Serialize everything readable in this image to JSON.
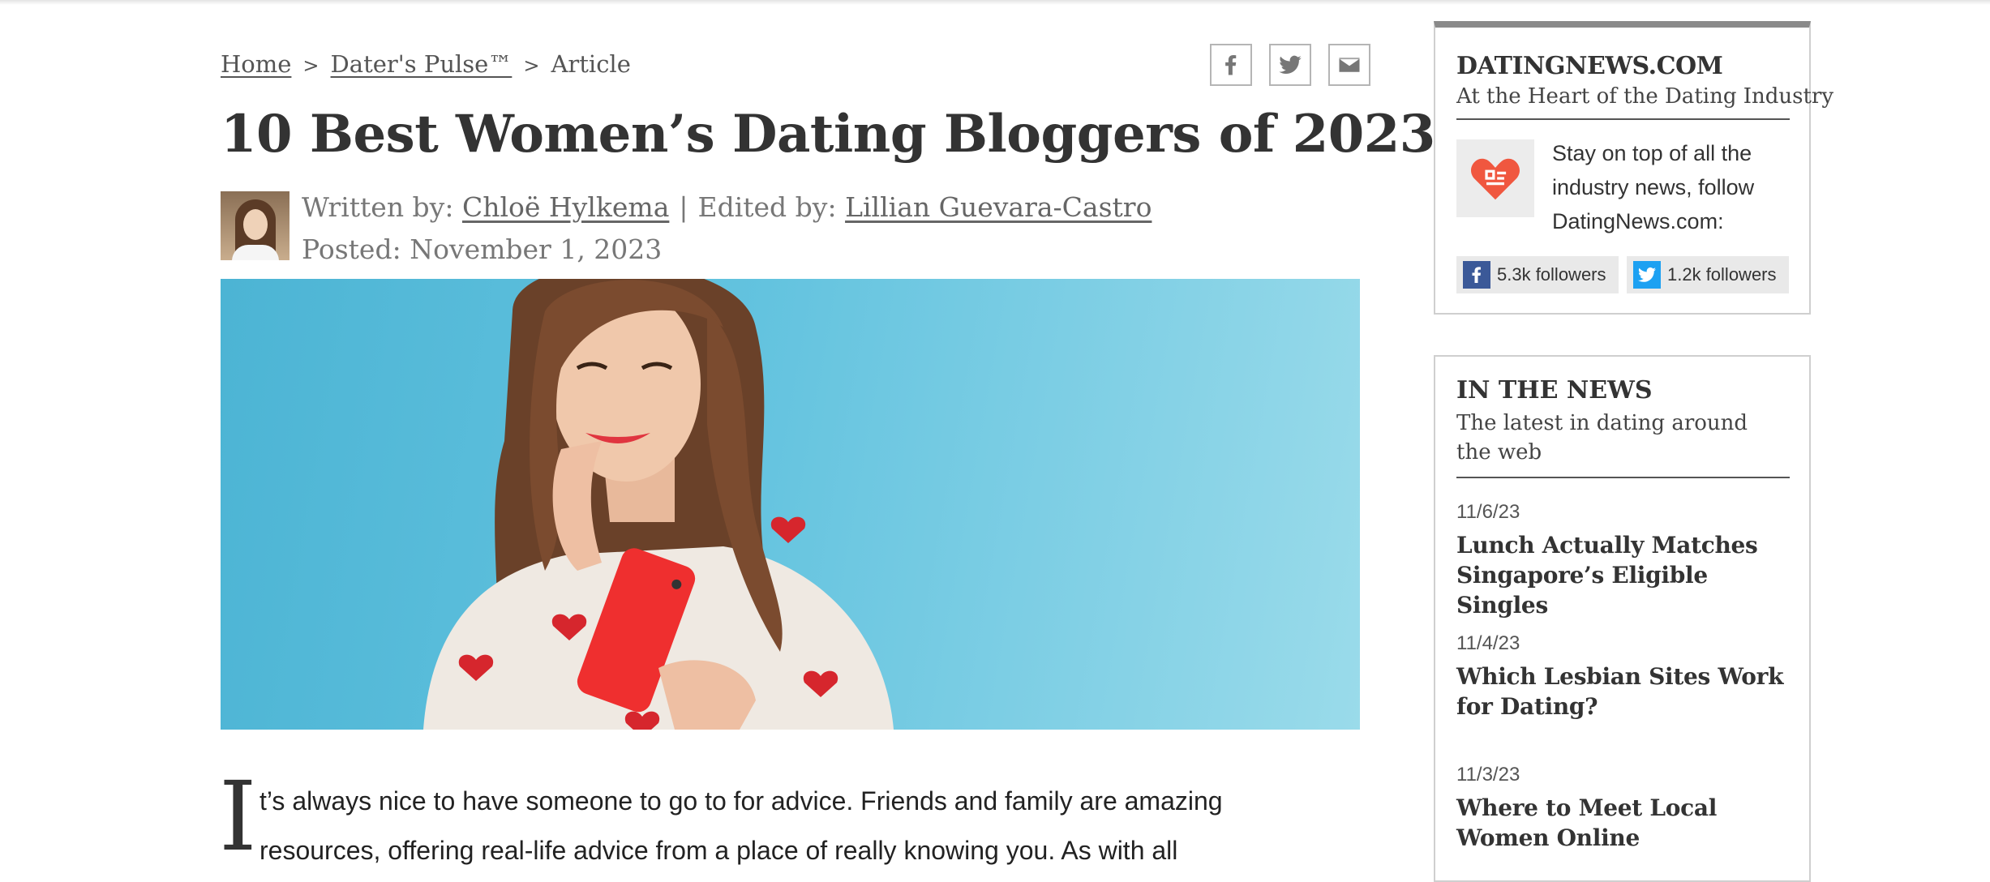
{
  "breadcrumb": {
    "home": "Home",
    "section": "Dater's Pulse™",
    "current": "Article",
    "sep": ">"
  },
  "share": {
    "facebook_icon": "facebook-icon",
    "twitter_icon": "twitter-icon",
    "email_icon": "mail-icon"
  },
  "article": {
    "title": "10 Best Women’s Dating Bloggers of 2023",
    "written_by_label": "Written by:",
    "author": "Chloë Hylkema",
    "edited_by_label": "Edited by:",
    "editor": "Lillian Guevara-Castro",
    "pipe": "|",
    "posted": "Posted: November 1, 2023",
    "dropcap": "I",
    "intro_line1": "t’s always nice to have someone to go to for advice. Friends and family are amazing",
    "intro_line2": "resources, offering real-life advice from a place of really knowing you. As with all"
  },
  "sidebar": {
    "brand": "DATINGNEWS.COM",
    "tagline": "At the Heart of the Dating Industry",
    "follow_text": "Stay on top of all the industry news, follow DatingNews.com:",
    "facebook_followers": "5.3k followers",
    "twitter_followers": "1.2k followers",
    "news_title": "IN THE NEWS",
    "news_subtitle": "The latest in dating around the web",
    "news": [
      {
        "date": "11/6/23",
        "headline": "Lunch Actually Matches Singapore’s Eligible Singles"
      },
      {
        "date": "11/4/23",
        "headline": "Which Lesbian Sites Work for Dating?"
      },
      {
        "date": "11/3/23",
        "headline": "Where to Meet Local Women Online"
      }
    ]
  },
  "colors": {
    "facebook": "#3b5998",
    "twitter": "#1da1f2",
    "logo": "#f0573f",
    "hero_bg": "#63c3df"
  }
}
